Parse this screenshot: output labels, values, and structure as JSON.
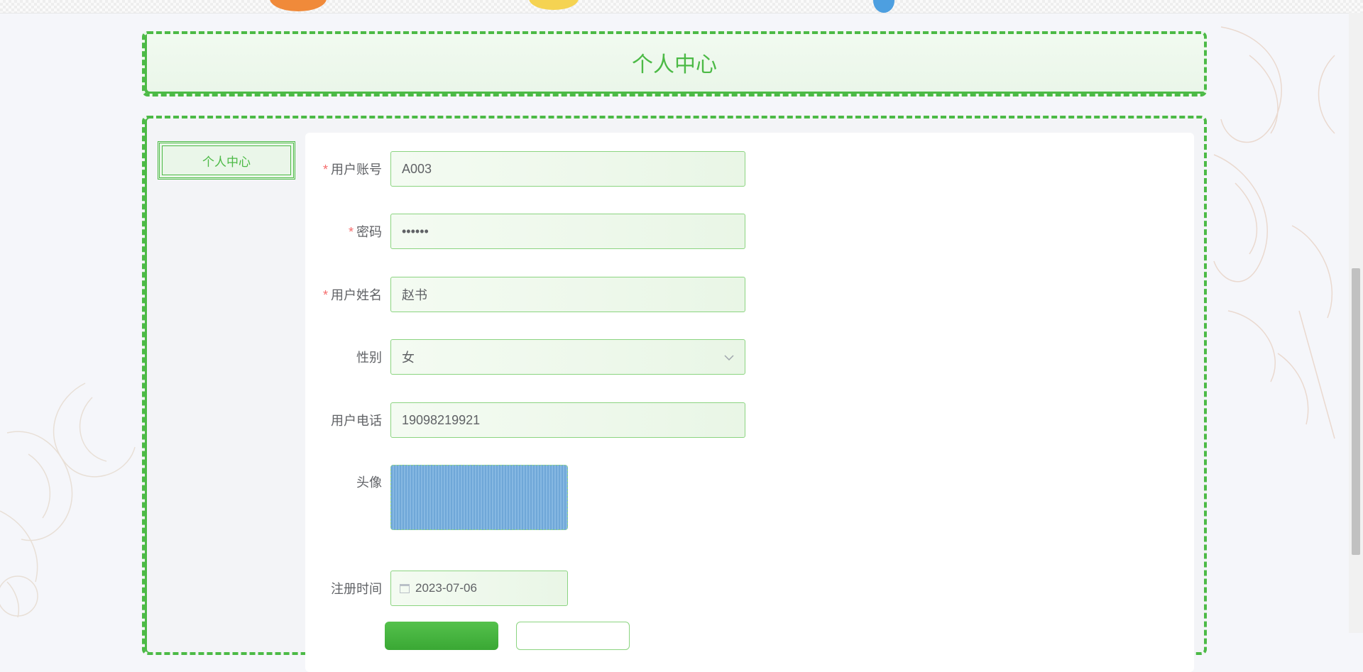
{
  "page": {
    "title": "个人中心"
  },
  "sidebar": {
    "items": [
      {
        "label": "个人中心"
      }
    ]
  },
  "form": {
    "fields": {
      "account": {
        "label": "用户账号",
        "required": true,
        "value": "A003"
      },
      "password": {
        "label": "密码",
        "required": true,
        "value": "••••••"
      },
      "name": {
        "label": "用户姓名",
        "required": true,
        "value": "赵书"
      },
      "gender": {
        "label": "性别",
        "required": false,
        "value": "女"
      },
      "phone": {
        "label": "用户电话",
        "required": false,
        "value": "19098219921"
      },
      "avatar": {
        "label": "头像"
      },
      "register_time": {
        "label": "注册时间",
        "value": "2023-07-06"
      }
    },
    "required_mark": "*"
  },
  "colors": {
    "accent": "#4cba46",
    "background": "#f5f6fa",
    "required": "#f56c6c"
  },
  "icons": {
    "gender_dropdown": "chevron-down-icon",
    "register_time": "calendar-icon"
  }
}
